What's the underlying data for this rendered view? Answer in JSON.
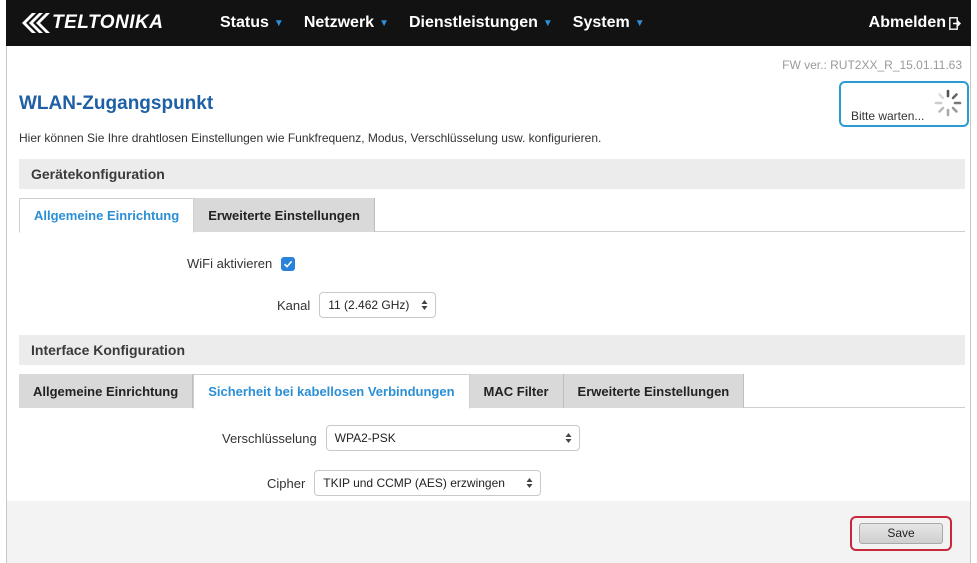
{
  "header": {
    "logo_text": "TELTONIKA",
    "nav": [
      "Status",
      "Netzwerk",
      "Dienstleistungen",
      "System"
    ],
    "logout_label": "Abmelden"
  },
  "firmware": "FW ver.: RUT2XX_R_15.01.11.63",
  "loading": {
    "text": "Bitte warten..."
  },
  "page": {
    "title": "WLAN-Zugangspunkt",
    "description": "Hier können Sie Ihre drahtlosen Einstellungen wie Funkfrequenz, Modus, Verschlüsselung usw. konfigurieren."
  },
  "device_config": {
    "title": "Gerätekonfiguration",
    "tabs": [
      "Allgemeine Einrichtung",
      "Erweiterte Einstellungen"
    ],
    "active_tab": "Allgemeine Einrichtung",
    "wifi_label": "WiFi aktivieren",
    "wifi_enabled": true,
    "channel_label": "Kanal",
    "channel_value": "11 (2.462 GHz)"
  },
  "interface_config": {
    "title": "Interface Konfiguration",
    "tabs": [
      "Allgemeine Einrichtung",
      "Sicherheit bei kabellosen Verbindungen",
      "MAC Filter",
      "Erweiterte Einstellungen"
    ],
    "active_tab": "Sicherheit bei kabellosen Verbindungen",
    "encryption_label": "Verschlüsselung",
    "encryption_value": "WPA2-PSK",
    "cipher_label": "Cipher",
    "cipher_value": "TKIP und CCMP (AES) erzwingen"
  },
  "footer": {
    "save_label": "Save"
  },
  "colors": {
    "topbar": "#121212",
    "accent_blue": "#2b8fd6",
    "title_blue": "#1e5fa6",
    "highlight_red": "#c8283b",
    "highlight_cyan": "#2b9bd4"
  }
}
